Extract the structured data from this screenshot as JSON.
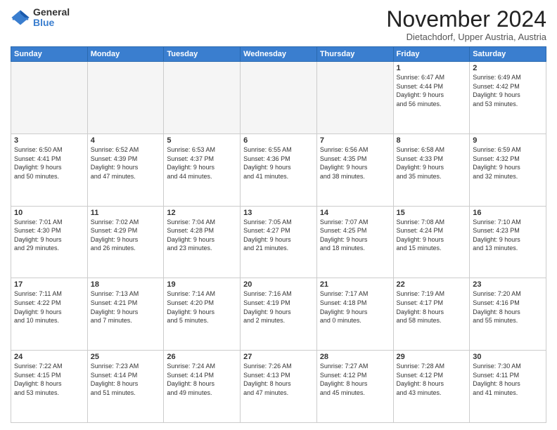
{
  "logo": {
    "general": "General",
    "blue": "Blue"
  },
  "header": {
    "month": "November 2024",
    "location": "Dietachdorf, Upper Austria, Austria"
  },
  "weekdays": [
    "Sunday",
    "Monday",
    "Tuesday",
    "Wednesday",
    "Thursday",
    "Friday",
    "Saturday"
  ],
  "weeks": [
    [
      {
        "day": "",
        "info": ""
      },
      {
        "day": "",
        "info": ""
      },
      {
        "day": "",
        "info": ""
      },
      {
        "day": "",
        "info": ""
      },
      {
        "day": "",
        "info": ""
      },
      {
        "day": "1",
        "info": "Sunrise: 6:47 AM\nSunset: 4:44 PM\nDaylight: 9 hours\nand 56 minutes."
      },
      {
        "day": "2",
        "info": "Sunrise: 6:49 AM\nSunset: 4:42 PM\nDaylight: 9 hours\nand 53 minutes."
      }
    ],
    [
      {
        "day": "3",
        "info": "Sunrise: 6:50 AM\nSunset: 4:41 PM\nDaylight: 9 hours\nand 50 minutes."
      },
      {
        "day": "4",
        "info": "Sunrise: 6:52 AM\nSunset: 4:39 PM\nDaylight: 9 hours\nand 47 minutes."
      },
      {
        "day": "5",
        "info": "Sunrise: 6:53 AM\nSunset: 4:37 PM\nDaylight: 9 hours\nand 44 minutes."
      },
      {
        "day": "6",
        "info": "Sunrise: 6:55 AM\nSunset: 4:36 PM\nDaylight: 9 hours\nand 41 minutes."
      },
      {
        "day": "7",
        "info": "Sunrise: 6:56 AM\nSunset: 4:35 PM\nDaylight: 9 hours\nand 38 minutes."
      },
      {
        "day": "8",
        "info": "Sunrise: 6:58 AM\nSunset: 4:33 PM\nDaylight: 9 hours\nand 35 minutes."
      },
      {
        "day": "9",
        "info": "Sunrise: 6:59 AM\nSunset: 4:32 PM\nDaylight: 9 hours\nand 32 minutes."
      }
    ],
    [
      {
        "day": "10",
        "info": "Sunrise: 7:01 AM\nSunset: 4:30 PM\nDaylight: 9 hours\nand 29 minutes."
      },
      {
        "day": "11",
        "info": "Sunrise: 7:02 AM\nSunset: 4:29 PM\nDaylight: 9 hours\nand 26 minutes."
      },
      {
        "day": "12",
        "info": "Sunrise: 7:04 AM\nSunset: 4:28 PM\nDaylight: 9 hours\nand 23 minutes."
      },
      {
        "day": "13",
        "info": "Sunrise: 7:05 AM\nSunset: 4:27 PM\nDaylight: 9 hours\nand 21 minutes."
      },
      {
        "day": "14",
        "info": "Sunrise: 7:07 AM\nSunset: 4:25 PM\nDaylight: 9 hours\nand 18 minutes."
      },
      {
        "day": "15",
        "info": "Sunrise: 7:08 AM\nSunset: 4:24 PM\nDaylight: 9 hours\nand 15 minutes."
      },
      {
        "day": "16",
        "info": "Sunrise: 7:10 AM\nSunset: 4:23 PM\nDaylight: 9 hours\nand 13 minutes."
      }
    ],
    [
      {
        "day": "17",
        "info": "Sunrise: 7:11 AM\nSunset: 4:22 PM\nDaylight: 9 hours\nand 10 minutes."
      },
      {
        "day": "18",
        "info": "Sunrise: 7:13 AM\nSunset: 4:21 PM\nDaylight: 9 hours\nand 7 minutes."
      },
      {
        "day": "19",
        "info": "Sunrise: 7:14 AM\nSunset: 4:20 PM\nDaylight: 9 hours\nand 5 minutes."
      },
      {
        "day": "20",
        "info": "Sunrise: 7:16 AM\nSunset: 4:19 PM\nDaylight: 9 hours\nand 2 minutes."
      },
      {
        "day": "21",
        "info": "Sunrise: 7:17 AM\nSunset: 4:18 PM\nDaylight: 9 hours\nand 0 minutes."
      },
      {
        "day": "22",
        "info": "Sunrise: 7:19 AM\nSunset: 4:17 PM\nDaylight: 8 hours\nand 58 minutes."
      },
      {
        "day": "23",
        "info": "Sunrise: 7:20 AM\nSunset: 4:16 PM\nDaylight: 8 hours\nand 55 minutes."
      }
    ],
    [
      {
        "day": "24",
        "info": "Sunrise: 7:22 AM\nSunset: 4:15 PM\nDaylight: 8 hours\nand 53 minutes."
      },
      {
        "day": "25",
        "info": "Sunrise: 7:23 AM\nSunset: 4:14 PM\nDaylight: 8 hours\nand 51 minutes."
      },
      {
        "day": "26",
        "info": "Sunrise: 7:24 AM\nSunset: 4:14 PM\nDaylight: 8 hours\nand 49 minutes."
      },
      {
        "day": "27",
        "info": "Sunrise: 7:26 AM\nSunset: 4:13 PM\nDaylight: 8 hours\nand 47 minutes."
      },
      {
        "day": "28",
        "info": "Sunrise: 7:27 AM\nSunset: 4:12 PM\nDaylight: 8 hours\nand 45 minutes."
      },
      {
        "day": "29",
        "info": "Sunrise: 7:28 AM\nSunset: 4:12 PM\nDaylight: 8 hours\nand 43 minutes."
      },
      {
        "day": "30",
        "info": "Sunrise: 7:30 AM\nSunset: 4:11 PM\nDaylight: 8 hours\nand 41 minutes."
      }
    ]
  ]
}
